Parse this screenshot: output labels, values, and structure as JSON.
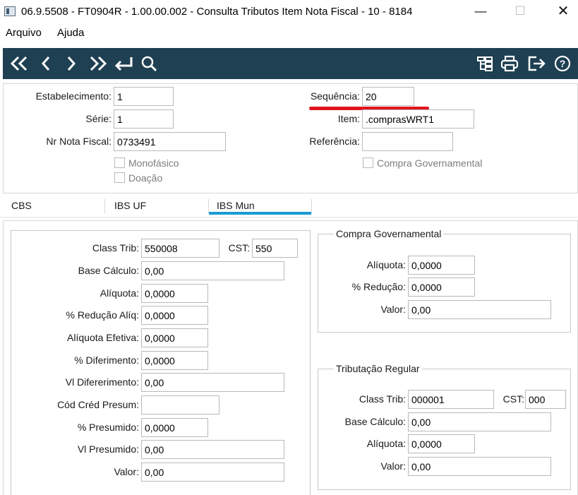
{
  "window": {
    "title": "06.9.5508 - FT0904R - 1.00.00.002 - Consulta Tributos Item Nota Fiscal - 10 - 8184",
    "minimize_glyph": "—",
    "maximize_glyph": "☐",
    "close_glyph": "✕"
  },
  "menu": {
    "items": [
      "Arquivo",
      "Ajuda"
    ]
  },
  "toolbar": {
    "icons": [
      "first-record-icon",
      "previous-record-icon",
      "next-record-icon",
      "last-record-icon",
      "goto-icon",
      "search-icon",
      "hierarchy-icon",
      "print-icon",
      "exit-icon",
      "help-icon"
    ],
    "help_glyph": "?"
  },
  "header": {
    "estabelecimento": {
      "label": "Estabelecimento:",
      "value": "1"
    },
    "serie": {
      "label": "Série:",
      "value": "1"
    },
    "nr_nota_fiscal": {
      "label": "Nr Nota Fiscal:",
      "value": "0733491"
    },
    "monofasico": {
      "label": "Monofásico",
      "checked": false
    },
    "doacao": {
      "label": "Doação",
      "checked": false
    },
    "sequencia": {
      "label": "Sequência:",
      "value": "20"
    },
    "item": {
      "label": "Item:",
      "value": ".comprasWRT1"
    },
    "referencia": {
      "label": "Referência:",
      "value": ""
    },
    "compra_governamental": {
      "label": "Compra Governamental",
      "checked": false
    },
    "highlight_color": "#e0141e"
  },
  "tabs": {
    "items": [
      "CBS",
      "IBS UF",
      "IBS Mun"
    ],
    "active": "IBS Mun",
    "active_color": "#1a9ad6"
  },
  "ibs_mun": {
    "class_trib": {
      "label": "Class Trib:",
      "value": "550008"
    },
    "cst": {
      "label": "CST:",
      "value": "550"
    },
    "base_calculo": {
      "label": "Base Cálculo:",
      "value": "0,00"
    },
    "aliquota": {
      "label": "Alíquota:",
      "value": "0,0000"
    },
    "perc_reducao_aliq": {
      "label": "% Redução Alíq:",
      "value": "0,0000"
    },
    "aliquota_efetiva": {
      "label": "Alíquota Efetiva:",
      "value": "0,0000"
    },
    "perc_diferimento": {
      "label": "% Diferimento:",
      "value": "0,0000"
    },
    "vl_diferimento": {
      "label": "Vl Difererimento:",
      "value": "0,00"
    },
    "cod_cred_presum": {
      "label": "Cód Créd Presum:",
      "value": ""
    },
    "perc_presumido": {
      "label": "% Presumido:",
      "value": "0,0000"
    },
    "vl_presumido": {
      "label": "Vl Presumido:",
      "value": "0,00"
    },
    "valor": {
      "label": "Valor:",
      "value": "0,00"
    }
  },
  "compra_governamental_group": {
    "title": "Compra Governamental",
    "aliquota": {
      "label": "Alíquota:",
      "value": "0,0000"
    },
    "perc_reducao": {
      "label": "% Redução:",
      "value": "0,0000"
    },
    "valor": {
      "label": "Valor:",
      "value": "0,00"
    }
  },
  "tributacao_regular_group": {
    "title": "Tributação Regular",
    "class_trib": {
      "label": "Class Trib:",
      "value": "000001"
    },
    "cst": {
      "label": "CST:",
      "value": "000"
    },
    "base_calculo": {
      "label": "Base Cálculo:",
      "value": "0,00"
    },
    "aliquota": {
      "label": "Alíquota:",
      "value": "0,0000"
    },
    "valor": {
      "label": "Valor:",
      "value": "0,00"
    }
  }
}
